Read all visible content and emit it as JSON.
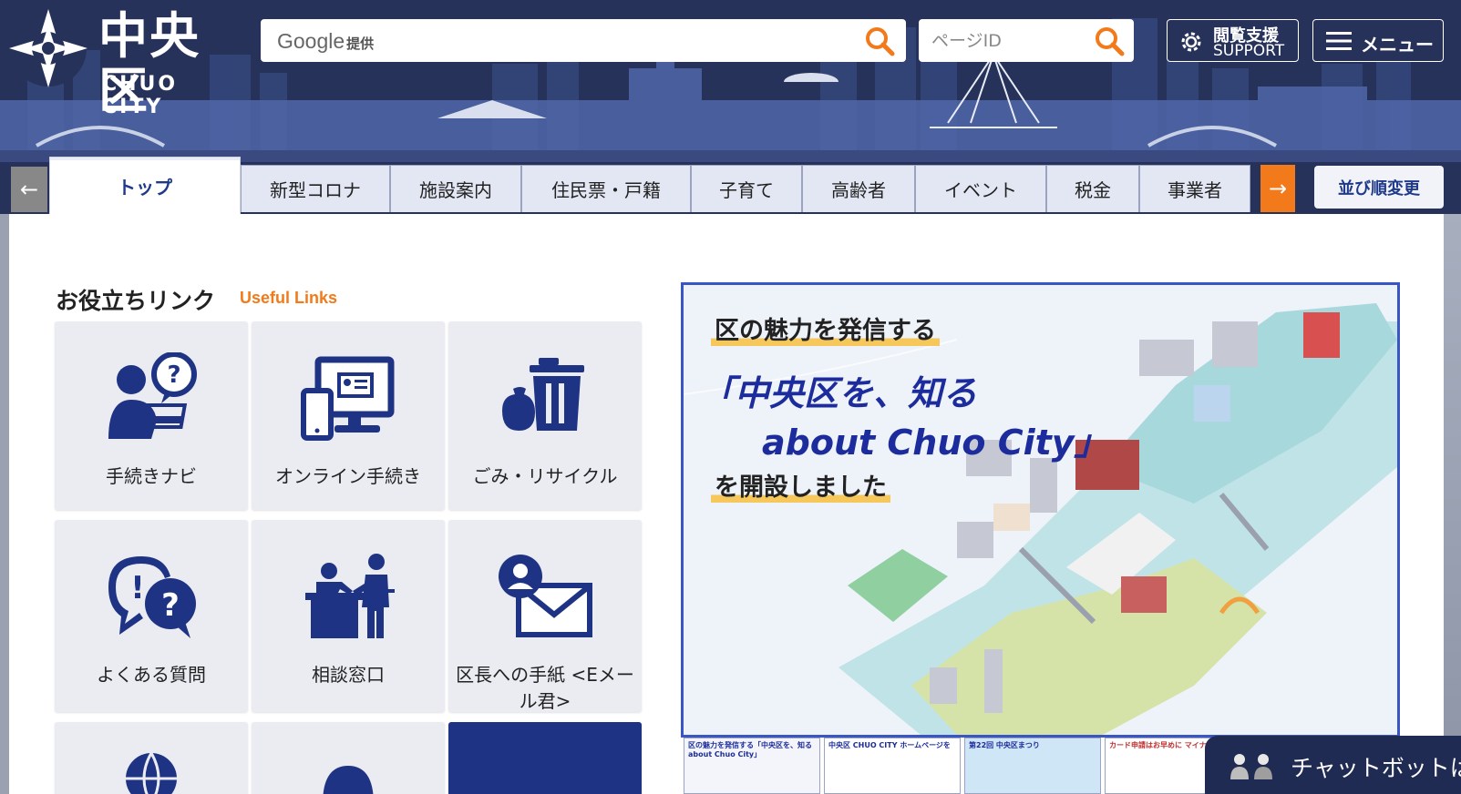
{
  "header": {
    "logo_jp": "中央区",
    "logo_en": "CHUO CITY",
    "search": {
      "provider_label": "Google",
      "provider_suffix": "提供",
      "value": ""
    },
    "page_id": {
      "placeholder": "ページID"
    },
    "support": {
      "line1": "閲覧支援",
      "line2": "SUPPORT"
    },
    "menu_label": "メニュー"
  },
  "tabs": {
    "items": [
      "トップ",
      "新型コロナ",
      "施設案内",
      "住民票・戸籍",
      "子育て",
      "高齢者",
      "イベント",
      "税金",
      "事業者"
    ],
    "active": "トップ",
    "sort_label": "並び順変更"
  },
  "useful_links": {
    "title": "お役立ちリンク",
    "subtitle": "Useful Links",
    "items": [
      {
        "label": "手続きナビ",
        "icon": "person-question-icon"
      },
      {
        "label": "オンライン手続き",
        "icon": "online-device-icon"
      },
      {
        "label": "ごみ・リサイクル",
        "icon": "trash-recycle-icon"
      },
      {
        "label": "よくある質問",
        "icon": "faq-bubble-icon"
      },
      {
        "label": "相談窓口",
        "icon": "consultation-counter-icon"
      },
      {
        "label": "区長への手紙 <Eメール君>",
        "icon": "person-mail-icon"
      }
    ]
  },
  "banner": {
    "line1": "区の魅力を発信する",
    "line2": "「中央区を、知る",
    "line3": "about Chuo City」",
    "line4": "を開設しました"
  },
  "thumbnails": [
    {
      "text": "区の魅力を発信する「中央区を、知る about Chuo City」"
    },
    {
      "text": "中央区 CHUO CITY ホームページを"
    },
    {
      "text": "第22回 中央区まつり"
    },
    {
      "text": "カード申請はお早めに マイナポイント"
    }
  ],
  "chatbot": {
    "label": "チャットボットは"
  },
  "colors": {
    "navy": "#27325a",
    "accent_orange": "#f27a1a",
    "icon_blue": "#1f3384",
    "banner_border": "#3a55c4"
  }
}
